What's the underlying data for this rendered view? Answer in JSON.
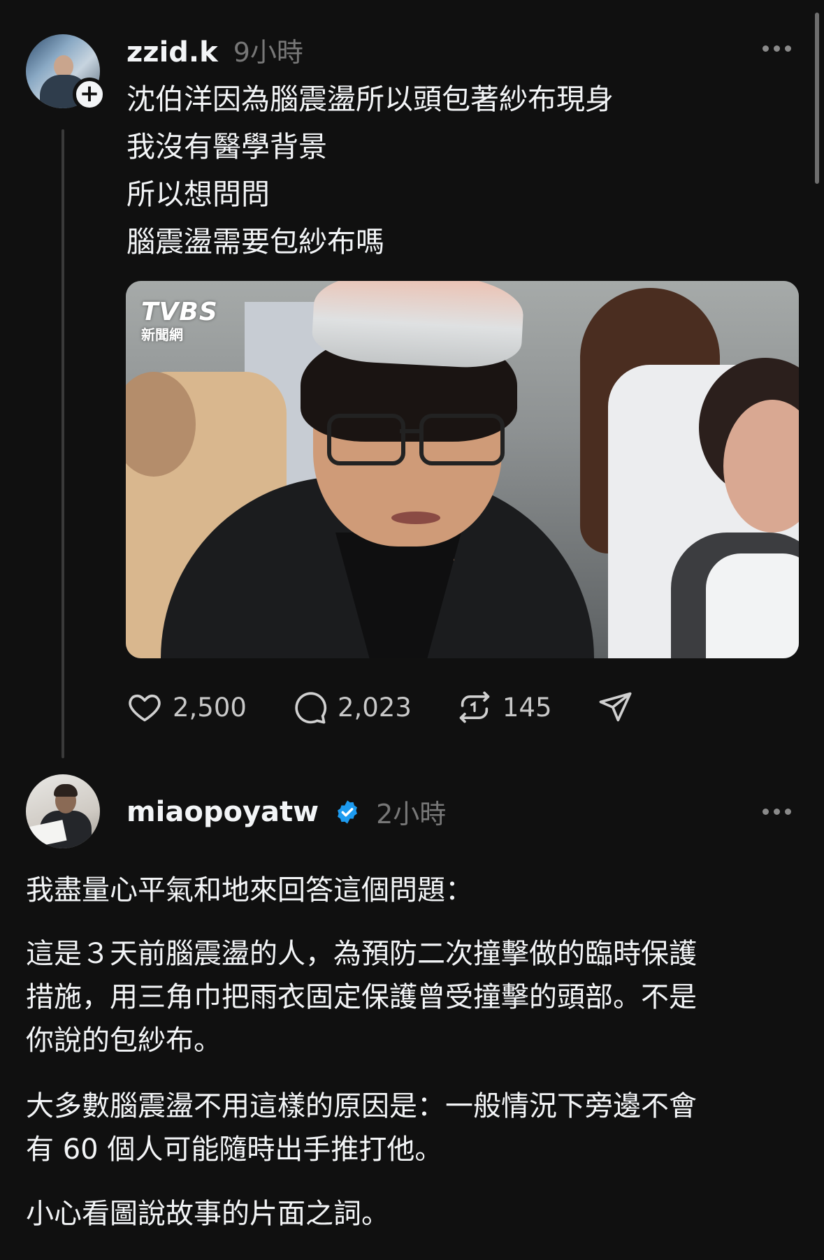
{
  "post": {
    "username": "zzid.k",
    "time": "9小時",
    "lines": [
      "沈伯洋因為腦震盪所以頭包著紗布現身",
      "我沒有醫學背景",
      "所以想問問",
      "腦震盪需要包紗布嗎"
    ],
    "media": {
      "logo": "TVBS",
      "logo_sub": "新聞網"
    },
    "stats": {
      "likes": "2,500",
      "replies": "2,023",
      "reposts": "145"
    }
  },
  "reply": {
    "username": "miaopoyatw",
    "time": "2小時",
    "paragraphs": [
      [
        "我盡量心平氣和地來回答這個問題："
      ],
      [
        "這是３天前腦震盪的人，為預防二次撞擊做的臨時保護",
        "措施，用三角巾把雨衣固定保護曾受撞擊的頭部。不是",
        "你說的包紗布。"
      ],
      [
        "大多數腦震盪不用這樣的原因是：一般情況下旁邊不會",
        "有 60 個人可能隨時出手推打他。"
      ],
      [
        "小心看圖說故事的片面之詞。"
      ]
    ]
  },
  "colors": {
    "background": "#101010",
    "text": "#f3f5f7",
    "muted": "#777777",
    "verified": "#1d9bf0"
  }
}
